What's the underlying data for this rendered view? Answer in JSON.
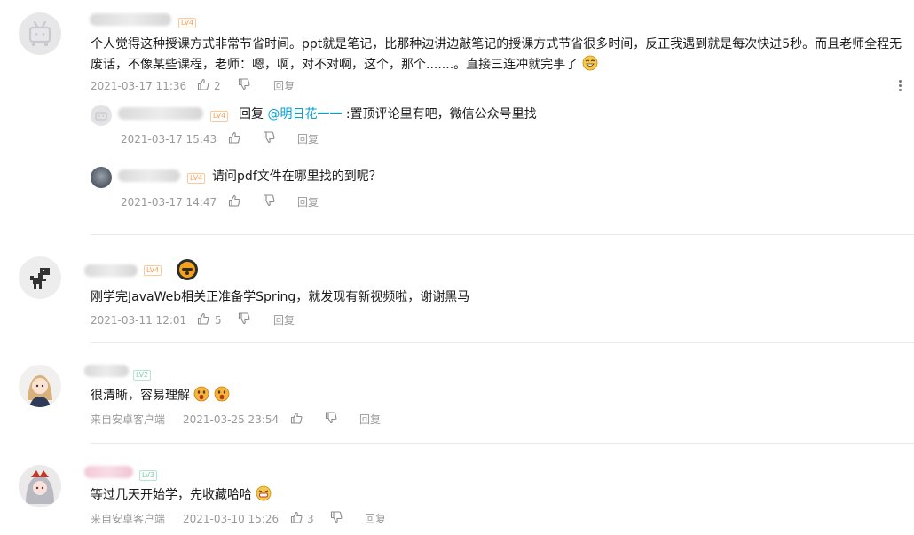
{
  "comments": [
    {
      "level": "LV4",
      "text_line1": "个人觉得这种授课方式非常节省时间。ppt就是笔记，比那种边讲边敲笔记的授课方式节省很多时间，反正我遇到就是每次快进5秒。而且老师全程无",
      "text_line2": "废话，不像某些课程，老师：嗯，啊，对不对啊，这个，那个.......。直接三连冲就完事了",
      "time": "2021-03-17 11:36",
      "likes": "2",
      "reply_label": "回复",
      "replies": [
        {
          "level": "LV4",
          "prefix": "回复 ",
          "mention": "@明日花一一",
          "text": " :置顶评论里有吧，微信公众号里找",
          "time": "2021-03-17 15:43",
          "reply_label": "回复"
        },
        {
          "level": "LV4",
          "text": "请问pdf文件在哪里找的到呢？",
          "time": "2021-03-17 14:47",
          "reply_label": "回复"
        }
      ]
    },
    {
      "level": "LV4",
      "text": "刚学完JavaWeb相关正准备学Spring，就发现有新视频啦，谢谢黑马",
      "time": "2021-03-11 12:01",
      "likes": "5",
      "reply_label": "回复"
    },
    {
      "level": "LV2",
      "text": "很清晰，容易理解",
      "source": "来自安卓客户端",
      "time": "2021-03-25 23:54",
      "reply_label": "回复"
    },
    {
      "level": "LV3",
      "text": "等过几天开始学，先收藏哈哈",
      "source": "来自安卓客户端",
      "time": "2021-03-10 15:26",
      "likes": "3",
      "reply_label": "回复"
    }
  ],
  "colors": {
    "link": "#00a1d6",
    "meta": "#999999",
    "level_orange": "#ff9d4c",
    "level_green": "#7bd0a9"
  },
  "icons": [
    "like-icon",
    "dislike-icon",
    "more-menu-icon",
    "emoji-icon"
  ]
}
